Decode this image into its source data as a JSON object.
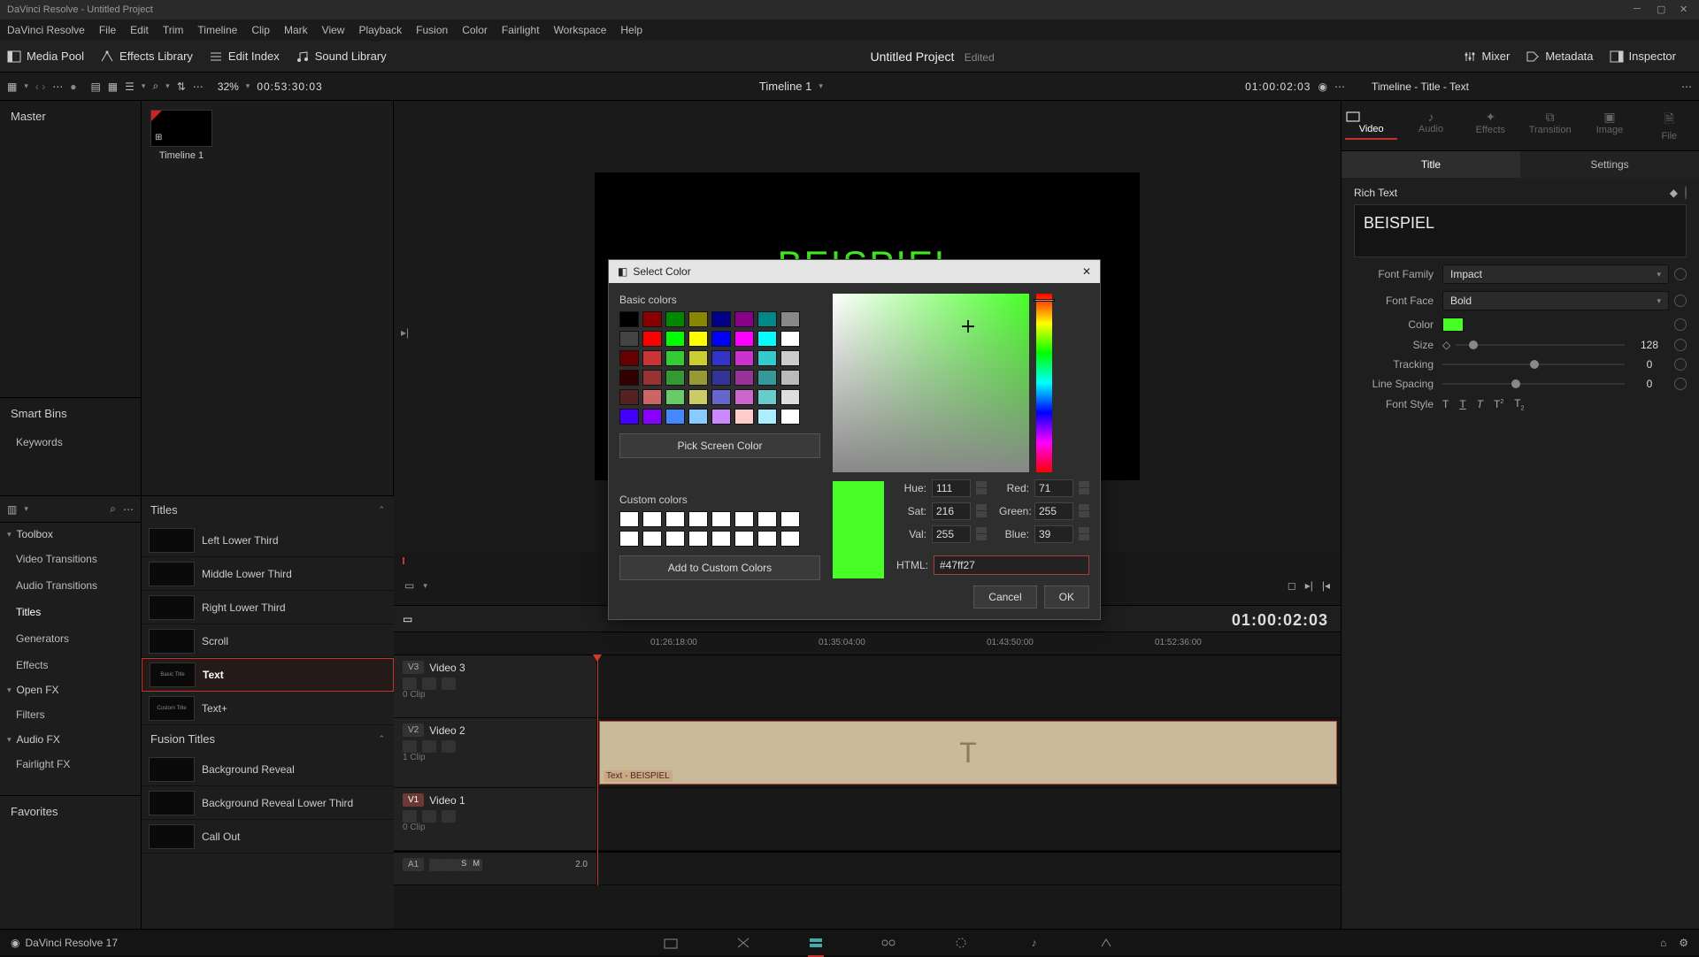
{
  "titlebar": "DaVinci Resolve - Untitled Project",
  "menu": [
    "DaVinci Resolve",
    "File",
    "Edit",
    "Trim",
    "Timeline",
    "Clip",
    "Mark",
    "View",
    "Playback",
    "Fusion",
    "Color",
    "Fairlight",
    "Workspace",
    "Help"
  ],
  "toolbar": {
    "mediaPool": "Media Pool",
    "effectsLib": "Effects Library",
    "editIndex": "Edit Index",
    "soundLib": "Sound Library",
    "project": "Untitled Project",
    "edited": "Edited",
    "mixer": "Mixer",
    "metadata": "Metadata",
    "inspector": "Inspector"
  },
  "secbar": {
    "zoom": "32%",
    "tcLeft": "00:53:30:03",
    "timeline": "Timeline 1",
    "tcRight": "01:00:02:03"
  },
  "leftPane": {
    "master": "Master",
    "smartBins": "Smart Bins",
    "keywords": "Keywords"
  },
  "mediaPane": {
    "clip1": "Timeline 1"
  },
  "toolbox": {
    "header": "Toolbox",
    "items": [
      "Video Transitions",
      "Audio Transitions",
      "Titles",
      "Generators",
      "Effects"
    ],
    "openfx": "Open FX",
    "filters": "Filters",
    "audiofx": "Audio FX",
    "fairlight": "Fairlight FX",
    "favorites": "Favorites"
  },
  "titles": {
    "header": "Titles",
    "items": [
      "Left Lower Third",
      "Middle Lower Third",
      "Right Lower Third",
      "Scroll",
      "Text",
      "Text+"
    ],
    "fusionHeader": "Fusion Titles",
    "fusionItems": [
      "Background Reveal",
      "Background Reveal Lower Third",
      "Call Out"
    ]
  },
  "viewer": {
    "text": "BEISPIEL"
  },
  "bigtc": "01:00:02:03",
  "ruler": [
    "01:26:18:00",
    "01:35:04:00",
    "01:43:50:00",
    "01:52:36:00"
  ],
  "tracks": {
    "v3": {
      "badge": "V3",
      "name": "Video 3",
      "sub": "0 Clip"
    },
    "v2": {
      "badge": "V2",
      "name": "Video 2",
      "sub": "1 Clip"
    },
    "v1": {
      "badge": "V1",
      "name": "Video 1",
      "sub": "0 Clip"
    },
    "a1": {
      "badge": "A1",
      "name": "",
      "gain": "2.0"
    }
  },
  "clip": {
    "label": "Text - BEISPIEL",
    "glyph": "T"
  },
  "inspector": {
    "title": "Timeline - Title - Text",
    "tabs": [
      "Video",
      "Audio",
      "Effects",
      "Transition",
      "Image",
      "File"
    ],
    "subtabs": [
      "Title",
      "Settings"
    ],
    "richText": "Rich Text",
    "textValue": "BEISPIEL",
    "fontFamily": {
      "label": "Font Family",
      "value": "Impact"
    },
    "fontFace": {
      "label": "Font Face",
      "value": "Bold"
    },
    "colorLbl": "Color",
    "size": {
      "label": "Size",
      "value": "128"
    },
    "tracking": {
      "label": "Tracking",
      "value": "0"
    },
    "lineSpacing": {
      "label": "Line Spacing",
      "value": "0"
    },
    "fontStyle": "Font Style"
  },
  "dialog": {
    "title": "Select Color",
    "basic": "Basic colors",
    "pickScreen": "Pick Screen Color",
    "custom": "Custom colors",
    "addCustom": "Add to Custom Colors",
    "hue": {
      "label": "Hue:",
      "value": "111"
    },
    "sat": {
      "label": "Sat:",
      "value": "216"
    },
    "val": {
      "label": "Val:",
      "value": "255"
    },
    "red": {
      "label": "Red:",
      "value": "71"
    },
    "green": {
      "label": "Green:",
      "value": "255"
    },
    "blue": {
      "label": "Blue:",
      "value": "39"
    },
    "htmlLbl": "HTML:",
    "htmlVal": "#47ff27",
    "cancel": "Cancel",
    "ok": "OK",
    "basicColors": [
      "#000",
      "#800",
      "#080",
      "#880",
      "#008",
      "#808",
      "#088",
      "#888",
      "#444",
      "#f00",
      "#0f0",
      "#ff0",
      "#00f",
      "#f0f",
      "#0ff",
      "#fff",
      "#600",
      "#c33",
      "#3c3",
      "#cc3",
      "#33c",
      "#c3c",
      "#3cc",
      "#ccc",
      "#300",
      "#933",
      "#393",
      "#993",
      "#339",
      "#939",
      "#399",
      "#bbb",
      "#522",
      "#c66",
      "#6c6",
      "#cc6",
      "#66c",
      "#c6c",
      "#6cc",
      "#ddd",
      "#40f",
      "#80f",
      "#48f",
      "#8cf",
      "#c8f",
      "#fcc",
      "#aef",
      "#fff"
    ]
  },
  "pagebar": {
    "appname": "DaVinci Resolve 17"
  }
}
